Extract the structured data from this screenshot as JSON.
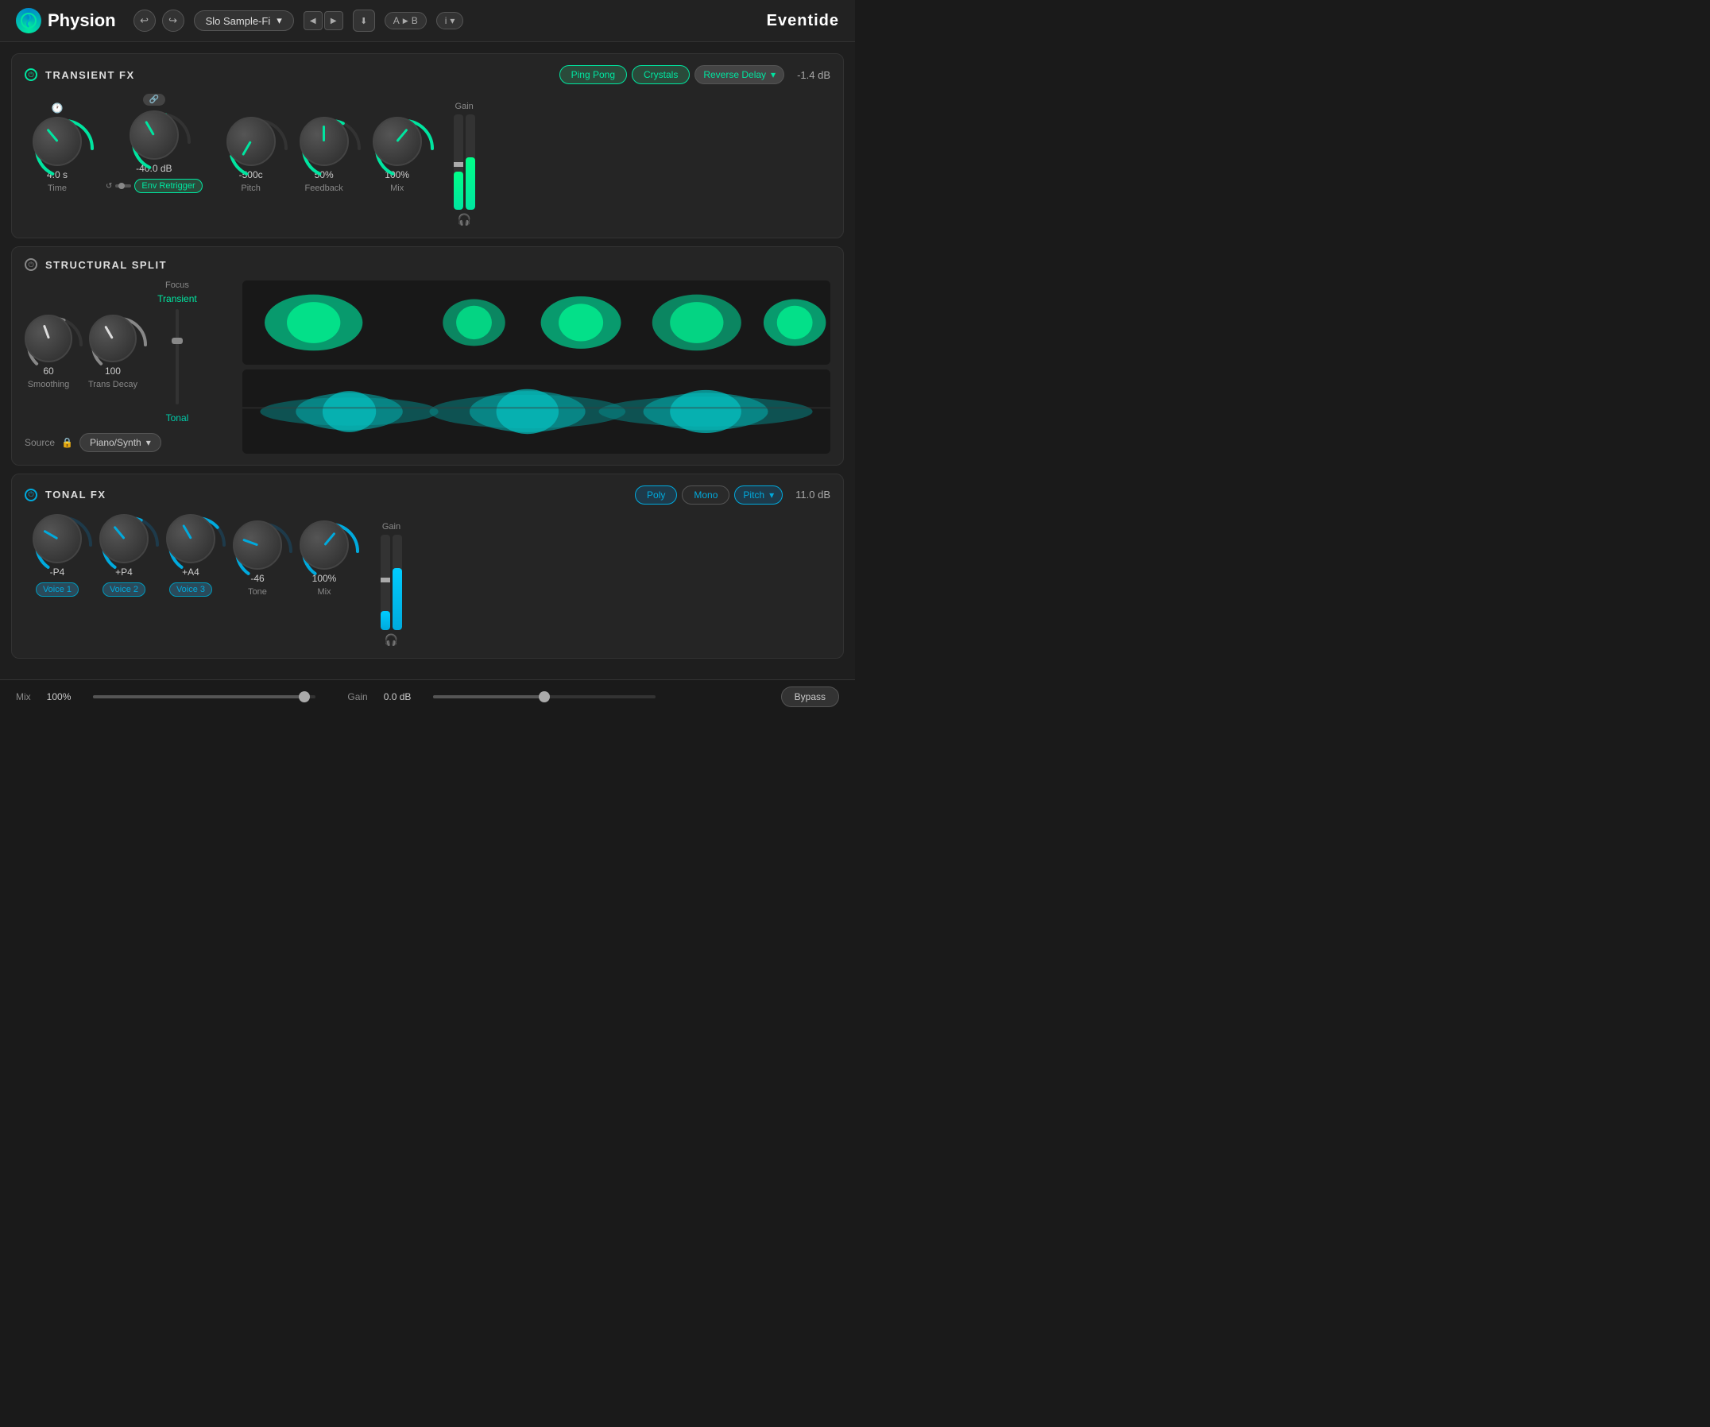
{
  "app": {
    "name": "Physion",
    "brand": "Eventide"
  },
  "header": {
    "undo_label": "↩",
    "redo_label": "↪",
    "preset_name": "Slo Sample-Fi",
    "prev_preset": "◀",
    "next_preset": "▶",
    "download_icon": "⬇",
    "ab_a": "A",
    "ab_play": "▶",
    "ab_b": "B",
    "info": "i",
    "info_arrow": "▾"
  },
  "transient_fx": {
    "title": "TRANSIENT FX",
    "fx_buttons": [
      "Ping Pong",
      "Crystals",
      "Reverse Delay"
    ],
    "gain_value": "-1.4 dB",
    "knobs": [
      {
        "value": "4.0 s",
        "label": "Time",
        "icon": "🕐",
        "rotation": -40
      },
      {
        "value": "-40.0 dB",
        "label": "Env Retrigger",
        "rotation": -30,
        "badge": "Env Retrigger"
      },
      {
        "value": "-500c",
        "label": "Pitch",
        "rotation": -150
      },
      {
        "value": "50%",
        "label": "Feedback",
        "rotation": 0
      },
      {
        "value": "100%",
        "label": "Mix",
        "rotation": 40
      }
    ]
  },
  "structural_split": {
    "title": "STRUCTURAL SPLIT",
    "focus_label": "Focus",
    "transient_label": "Transient",
    "tonal_label": "Tonal",
    "knobs": [
      {
        "value": "60",
        "label": "Smoothing",
        "rotation": -20
      },
      {
        "value": "100",
        "label": "Trans Decay",
        "rotation": -30
      }
    ],
    "source_label": "Source",
    "source_value": "Piano/Synth"
  },
  "tonal_fx": {
    "title": "TONAL FX",
    "fx_buttons": [
      "Poly",
      "Mono"
    ],
    "fx_dropdown": "Pitch",
    "gain_value": "11.0 dB",
    "knobs": [
      {
        "value": "-P4",
        "label": "Voice 1",
        "rotation": -60
      },
      {
        "value": "+P4",
        "label": "Voice 2",
        "rotation": -40
      },
      {
        "value": "+A4",
        "label": "Voice 3",
        "rotation": -30
      },
      {
        "value": "-46",
        "label": "Tone",
        "rotation": -70
      },
      {
        "value": "100%",
        "label": "Mix",
        "rotation": 40
      }
    ]
  },
  "bottom_bar": {
    "mix_label": "Mix",
    "mix_value": "100%",
    "mix_slider_pct": 95,
    "gain_label": "Gain",
    "gain_value": "0.0 dB",
    "gain_slider_pct": 50,
    "bypass_label": "Bypass"
  }
}
